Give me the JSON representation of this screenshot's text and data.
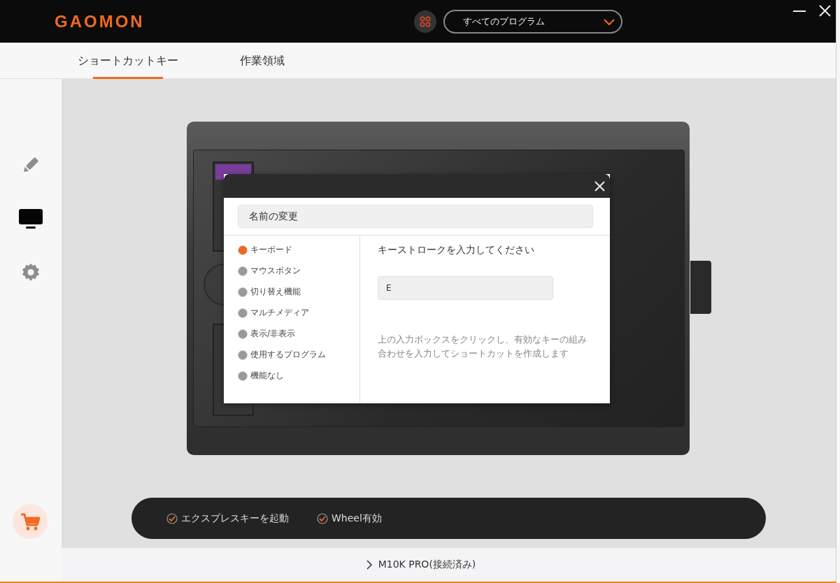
{
  "header": {
    "logo": "GAOMON",
    "program_select": {
      "value": "すべてのプログラム"
    }
  },
  "tabs": [
    {
      "label": "ショートカットキー",
      "selected": true
    },
    {
      "label": "作業領域",
      "selected": false
    }
  ],
  "sidebar": {
    "items": [
      {
        "kind": "pen",
        "selected": false
      },
      {
        "kind": "display",
        "selected": true
      },
      {
        "kind": "settings",
        "selected": false
      }
    ]
  },
  "dialog": {
    "name_field": {
      "value": "名前の変更"
    },
    "functions": [
      {
        "label": "キーボード",
        "selected": true
      },
      {
        "label": "マウスボタン",
        "selected": false
      },
      {
        "label": "切り替え機能",
        "selected": false
      },
      {
        "label": "マルチメディア",
        "selected": false
      },
      {
        "label": "表示/非表示",
        "selected": false
      },
      {
        "label": "使用するプログラム",
        "selected": false
      },
      {
        "label": "機能なし",
        "selected": false
      }
    ],
    "prompt": "キーストロークを入力してください",
    "key_field": {
      "value": "E"
    },
    "hint": "上の入力ボックスをクリックし、有効なキーの組み合わせを入力してショートカットを作成します"
  },
  "options": [
    {
      "label": "エクスプレスキーを起動",
      "checked": true
    },
    {
      "label": "Wheel有効",
      "checked": true
    }
  ],
  "status_bar": {
    "device": "M10K PRO(接続済み)"
  }
}
